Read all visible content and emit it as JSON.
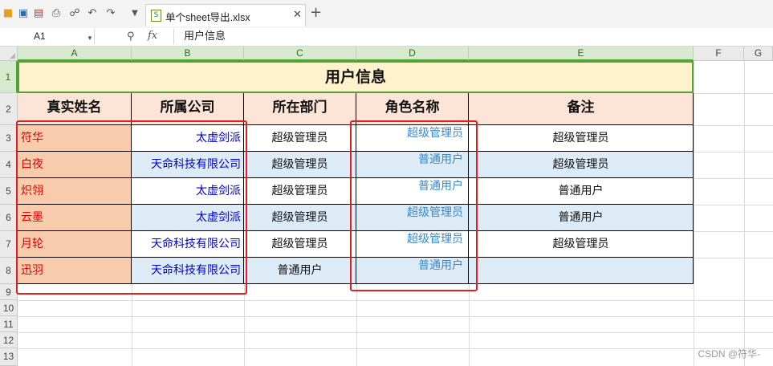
{
  "tab": {
    "title": "单个sheet导出.xlsx"
  },
  "formula_bar": {
    "cell_ref": "A1",
    "fx": "fx",
    "value": "用户信息"
  },
  "columns": [
    "A",
    "B",
    "C",
    "D",
    "E",
    "F",
    "G"
  ],
  "rows": [
    "1",
    "2",
    "3",
    "4",
    "5",
    "6",
    "7",
    "8",
    "9",
    "10",
    "11",
    "12",
    "13"
  ],
  "sheet": {
    "title": "用户信息",
    "headers": [
      "真实姓名",
      "所属公司",
      "所在部门",
      "角色名称",
      "备注"
    ],
    "records": [
      {
        "name": "符华",
        "company": "太虚剑派",
        "department": "超级管理员",
        "role": "超级管理员",
        "remark": "超级管理员"
      },
      {
        "name": "白夜",
        "company": "天命科技有限公司",
        "department": "超级管理员",
        "role": "普通用户",
        "remark": "超级管理员"
      },
      {
        "name": "炽翎",
        "company": "太虚剑派",
        "department": "超级管理员",
        "role": "普通用户",
        "remark": "普通用户"
      },
      {
        "name": "云墨",
        "company": "太虚剑派",
        "department": "超级管理员",
        "role": "超级管理员",
        "remark": "普通用户"
      },
      {
        "name": "月轮",
        "company": "天命科技有限公司",
        "department": "超级管理员",
        "role": "超级管理员",
        "remark": "超级管理员"
      },
      {
        "name": "迅羽",
        "company": "天命科技有限公司",
        "department": "普通用户",
        "role": "普通用户",
        "remark": ""
      }
    ]
  },
  "watermark": "CSDN @符华-",
  "colors": {
    "selection": "#53a236",
    "title_fill": "#fff2cc",
    "header_fill": "#fce4d6",
    "name_fill": "#f8cbad",
    "band_fill": "#ddebf7",
    "highlight_box": "#e02020"
  }
}
